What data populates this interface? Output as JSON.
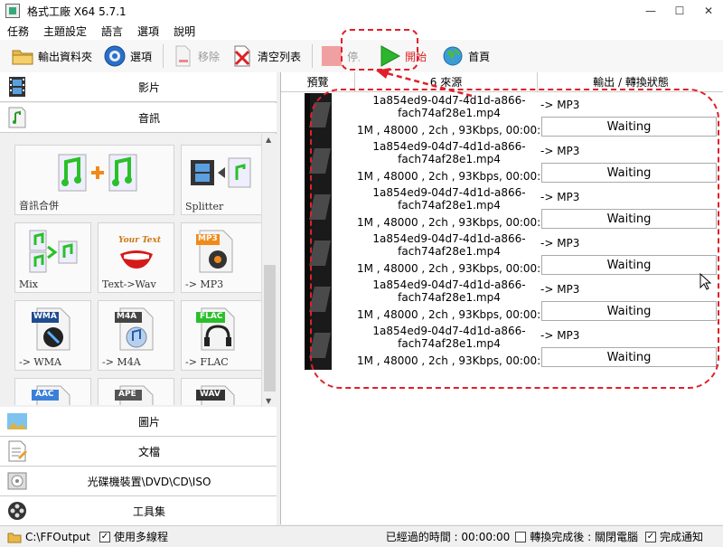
{
  "window": {
    "title": "格式工廠 X64 5.7.1",
    "minimize": "—",
    "maximize": "☐",
    "close": "✕"
  },
  "menu": [
    "任務",
    "主題設定",
    "語言",
    "選項",
    "說明"
  ],
  "toolbar": {
    "output_folder": "輸出資料夾",
    "options": "選項",
    "remove": "移除",
    "clear_list": "清空列表",
    "stop": "停止",
    "start": "開始",
    "home": "首頁"
  },
  "categories": {
    "video": "影片",
    "audio": "音訊",
    "picture": "圖片",
    "document": "文檔",
    "disc": "光碟機裝置\\DVD\\CD\\ISO",
    "tools": "工具集"
  },
  "tiles": {
    "audio_joiner": "音訊合併",
    "splitter": "Splitter",
    "mix": "Mix",
    "text_to_wav": "Text->Wav",
    "to_mp3": "-> MP3",
    "to_wma": "-> WMA",
    "to_m4a": "-> M4A",
    "to_flac": "-> FLAC",
    "badge_mp3": "MP3",
    "badge_wma": "WMA",
    "badge_m4a": "M4A",
    "badge_flac": "FLAC",
    "badge_aac": "AAC",
    "badge_ape": "APE",
    "badge_wav": "WAV",
    "your_text": "Your Text"
  },
  "list": {
    "col_preview": "預覽",
    "col_source": "6 來源",
    "col_output": "輸出 / 轉換狀態",
    "rows": [
      {
        "name": "1a854ed9-04d7-4d1d-a866-fach74af28e1.mp4",
        "info": "1M , 48000 , 2ch , 93Kbps, 00:00:",
        "output": "-> MP3",
        "status": "Waiting"
      },
      {
        "name": "1a854ed9-04d7-4d1d-a866-fach74af28e1.mp4",
        "info": "1M , 48000 , 2ch , 93Kbps, 00:00:",
        "output": "-> MP3",
        "status": "Waiting"
      },
      {
        "name": "1a854ed9-04d7-4d1d-a866-fach74af28e1.mp4",
        "info": "1M , 48000 , 2ch , 93Kbps, 00:00:",
        "output": "-> MP3",
        "status": "Waiting"
      },
      {
        "name": "1a854ed9-04d7-4d1d-a866-fach74af28e1.mp4",
        "info": "1M , 48000 , 2ch , 93Kbps, 00:00:",
        "output": "-> MP3",
        "status": "Waiting"
      },
      {
        "name": "1a854ed9-04d7-4d1d-a866-fach74af28e1.mp4",
        "info": "1M , 48000 , 2ch , 93Kbps, 00:00:",
        "output": "-> MP3",
        "status": "Waiting"
      },
      {
        "name": "1a854ed9-04d7-4d1d-a866-fach74af28e1.mp4",
        "info": "1M , 48000 , 2ch , 93Kbps, 00:00:",
        "output": "-> MP3",
        "status": "Waiting"
      }
    ]
  },
  "statusbar": {
    "output_path": "C:\\FFOutput",
    "multithread": "使用多線程",
    "elapsed": "已經過的時間 : 00:00:00",
    "after_convert": "轉換完成後 : 關閉電腦",
    "notify": "完成通知"
  },
  "colors": {
    "highlight": "#e0202a",
    "play_green": "#2db52d"
  }
}
